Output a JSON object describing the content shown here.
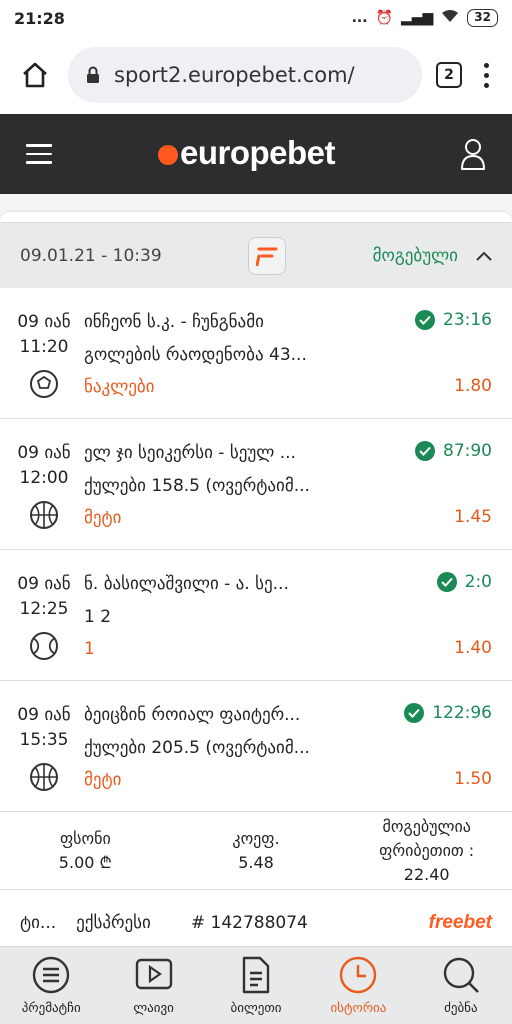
{
  "status_bar": {
    "time": "21:28",
    "signal": "...",
    "battery": "32"
  },
  "browser": {
    "url": "sport2.europebet.com/",
    "tab_count": "2"
  },
  "app": {
    "logo_text": "europebet"
  },
  "bet": {
    "date": "09.01.21 - 10:39",
    "status": "მოგებული",
    "events": [
      {
        "date": "09 იან",
        "time": "11:20",
        "sport_icon": "football-icon",
        "teams": "ინჩეონ ს.კ. - ჩუნგნამი",
        "market": "გოლების რაოდენობა 43...",
        "pick": "ნაკლები",
        "score": "23:16",
        "odd": "1.80"
      },
      {
        "date": "09 იან",
        "time": "12:00",
        "sport_icon": "basketball-icon",
        "teams": "ელ ჯი სეიკერსი - სეულ ...",
        "market": "ქულები 158.5 (ოვერტაიმ...",
        "pick": "მეტი",
        "score": "87:90",
        "odd": "1.45"
      },
      {
        "date": "09 იან",
        "time": "12:25",
        "sport_icon": "tennis-icon",
        "teams": "ნ. ბასილაშვილი - ა. სე...",
        "market": "1 2",
        "pick": "1",
        "score": "2:0",
        "odd": "1.40"
      },
      {
        "date": "09 იან",
        "time": "15:35",
        "sport_icon": "basketball-icon",
        "teams": "ბეიცზინ როიალ ფაიტერ...",
        "market": "ქულები 205.5 (ოვერტაიმ...",
        "pick": "მეტი",
        "score": "122:96",
        "odd": "1.50"
      }
    ],
    "summary": {
      "stake_label": "ფსონი",
      "stake_value": "5.00 ₾",
      "odds_label": "კოეფ.",
      "odds_value": "5.48",
      "win_label": "მოგებულია ფრიბეთით :",
      "win_value": "22.40"
    },
    "footer": {
      "type_short": "ტი...",
      "type": "ექსპრესი",
      "ticket_id": "# 142788074",
      "freebet": "freebet"
    }
  },
  "nav": [
    {
      "label": "პრემატჩი",
      "icon": "list-icon"
    },
    {
      "label": "ლაივი",
      "icon": "play-icon"
    },
    {
      "label": "ბილეთი",
      "icon": "ticket-icon"
    },
    {
      "label": "ისტორია",
      "icon": "clock-icon",
      "active": true
    },
    {
      "label": "ძებნა",
      "icon": "search-icon"
    }
  ],
  "colors": {
    "accent": "#e85a1a",
    "won": "#1a8a55",
    "header_bg": "#2b2d2e"
  }
}
